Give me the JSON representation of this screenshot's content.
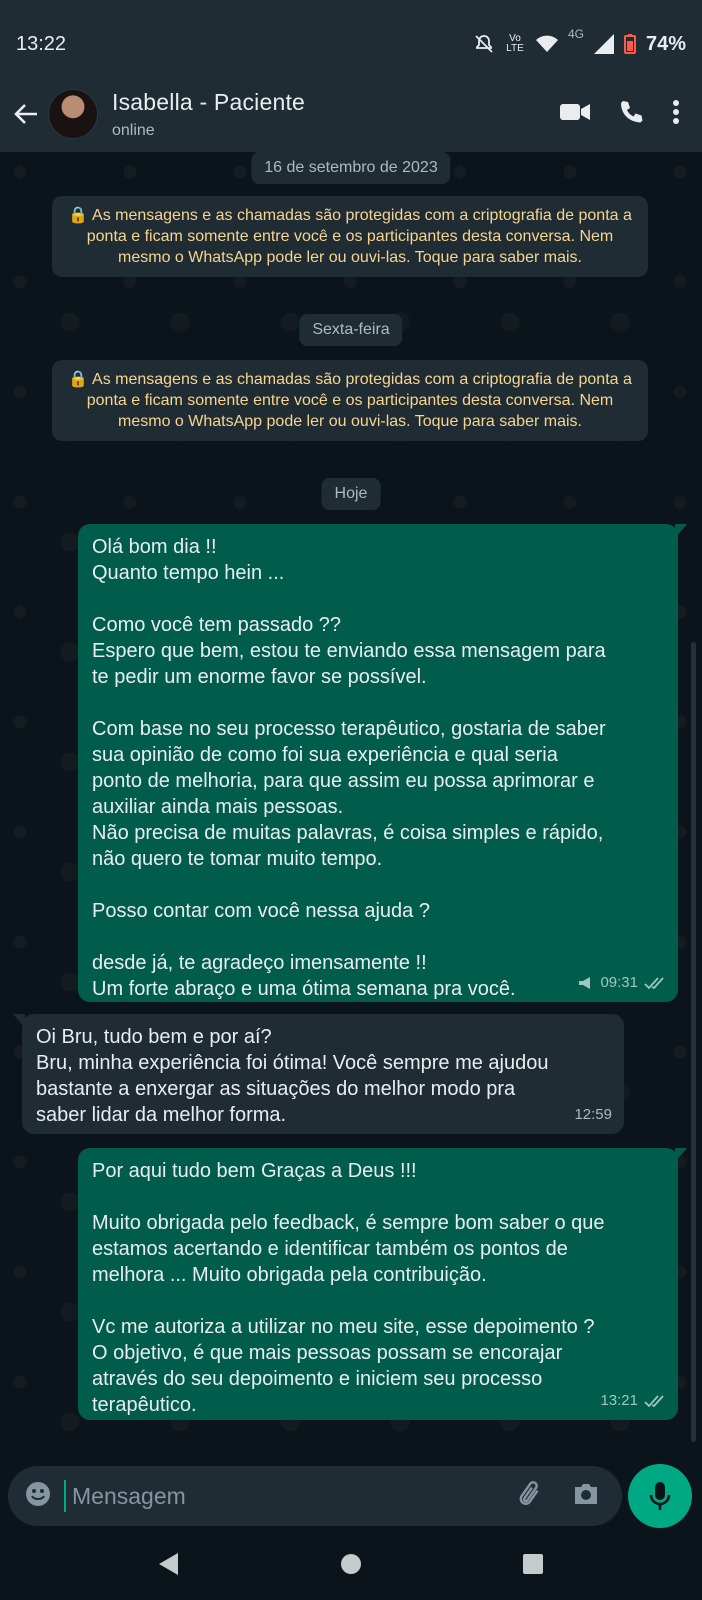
{
  "status_bar": {
    "time": "13:22",
    "network": "4G",
    "volte": "Vo LTE",
    "battery": "74%"
  },
  "header": {
    "contact_name": "Isabella - Paciente",
    "presence": "online",
    "icons": [
      "back-arrow-icon",
      "video-call-icon",
      "voice-call-icon",
      "more-options-icon"
    ]
  },
  "chat": {
    "date_pills": [
      "16 de setembro de 2023",
      "Sexta-feira",
      "Hoje"
    ],
    "encryption_notice": "As mensagens e as chamadas são protegidas com a criptografia de ponta a ponta e ficam somente entre você e os participantes desta conversa. Nem mesmo o WhatsApp pode ler ou ouvi-las. Toque para saber mais.",
    "messages": [
      {
        "direction": "outgoing",
        "lines": [
          "Olá bom dia !!",
          "Quanto tempo hein ...",
          "",
          "Como você tem passado ??",
          "Espero que bem, estou te enviando essa mensagem para",
          "te pedir um enorme favor se possível.",
          "",
          "Com base no seu processo terapêutico, gostaria de saber",
          "sua opinião de como foi sua experiência e qual seria",
          "ponto de melhoria, para que assim eu possa aprimorar e",
          "auxiliar ainda mais pessoas.",
          "Não precisa de muitas palavras, é coisa simples e rápido,",
          "não quero te tomar muito tempo.",
          "",
          "Posso contar com você nessa ajuda ?",
          "",
          "desde já, te agradeço imensamente !!",
          "Um forte abraço e uma ótima semana pra você."
        ],
        "time": "09:31",
        "broadcast": true,
        "status": "read"
      },
      {
        "direction": "incoming",
        "lines": [
          "Oi Bru, tudo bem e por aí?",
          "Bru, minha experiência foi ótima! Você sempre me ajudou",
          "bastante a enxergar as situações do melhor modo pra",
          "saber lidar da melhor forma."
        ],
        "time": "12:59"
      },
      {
        "direction": "outgoing",
        "lines": [
          "Por aqui tudo bem Graças a Deus !!!",
          "",
          "Muito obrigada pelo feedback, é sempre bom saber o que",
          "estamos acertando e identificar também os pontos de",
          "melhora ... Muito obrigada pela contribuição.",
          "",
          "Vc me autoriza a utilizar no meu site, esse depoimento ?",
          "O objetivo, é que mais pessoas possam se encorajar",
          "através do seu depoimento e iniciem seu processo",
          "terapêutico."
        ],
        "time": "13:21",
        "status": "read"
      }
    ]
  },
  "composer": {
    "placeholder": "Mensagem",
    "icons": [
      "emoji-icon",
      "attach-icon",
      "camera-icon",
      "mic-icon"
    ]
  },
  "nav": {
    "icons": [
      "nav-back-icon",
      "nav-home-icon",
      "nav-recents-icon"
    ]
  },
  "colors": {
    "outgoing_bubble": "#005c4b",
    "incoming_bubble": "#1f2c34",
    "chat_background": "#0b141a",
    "accent": "#00a884",
    "notice_text": "#f7d58f"
  }
}
